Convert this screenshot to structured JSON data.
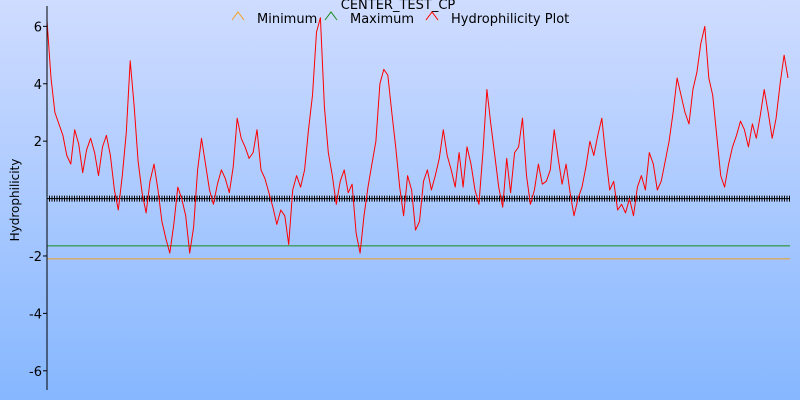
{
  "colors": {
    "background_top": "#cfdcff",
    "background_bottom": "#86b7ff",
    "axis": "#000000",
    "minimum": "#f0a020",
    "maximum": "#1a8c1a",
    "hydrophilicity": "#ff0000",
    "baseline_markers": "#000000"
  },
  "chart_data": {
    "type": "line",
    "title": "CENTER_TEST_CP",
    "xlabel": "",
    "ylabel": "Hydrophilicity",
    "ylim": [
      -6.6,
      6.5
    ],
    "xlim": [
      0,
      750
    ],
    "yticks": [
      -6,
      -4,
      -2,
      2,
      4,
      6
    ],
    "ytick_labels": [
      "-6",
      "-4",
      "-2",
      "2",
      "4",
      "6"
    ],
    "grid": false,
    "legend": {
      "placement": "top-center",
      "entries": [
        "Minimum",
        "Maximum",
        "Hydrophilicity Plot"
      ]
    },
    "reference_lines": [
      {
        "name": "Minimum",
        "y": -2.1
      },
      {
        "name": "Maximum",
        "y": -1.65
      }
    ],
    "baseline_y": 0,
    "series": [
      {
        "name": "Hydrophilicity Plot",
        "x": [
          0,
          4,
          8,
          12,
          16,
          20,
          24,
          28,
          32,
          36,
          40,
          44,
          48,
          52,
          56,
          60,
          64,
          68,
          72,
          76,
          80,
          84,
          88,
          92,
          96,
          100,
          104,
          108,
          112,
          116,
          120,
          124,
          128,
          132,
          136,
          140,
          144,
          148,
          152,
          156,
          160,
          164,
          168,
          172,
          176,
          180,
          184,
          188,
          192,
          196,
          200,
          204,
          208,
          212,
          216,
          220,
          224,
          228,
          232,
          236,
          240,
          244,
          248,
          252,
          256,
          260,
          264,
          268,
          272,
          276,
          280,
          284,
          288,
          292,
          296,
          300,
          304,
          308,
          312,
          316,
          320,
          324,
          328,
          332,
          336,
          340,
          344,
          348,
          352,
          356,
          360,
          364,
          368,
          372,
          376,
          380,
          384,
          388,
          392,
          396,
          400,
          404,
          408,
          412,
          416,
          420,
          424,
          428,
          432,
          436,
          440,
          444,
          448,
          452,
          456,
          460,
          464,
          468,
          472,
          476,
          480,
          484,
          488,
          492,
          496,
          500,
          504,
          508,
          512,
          516,
          520,
          524,
          528,
          532,
          536,
          540,
          544,
          548,
          552,
          556,
          560,
          564,
          568,
          572,
          576,
          580,
          584,
          588,
          592,
          596,
          600,
          604,
          608,
          612,
          616,
          620,
          624,
          628,
          632,
          636,
          640,
          644,
          648,
          652,
          656,
          660,
          664,
          668,
          672,
          676,
          680,
          684,
          688,
          692,
          696,
          700,
          704,
          708,
          712,
          716,
          720,
          724,
          728,
          732,
          736,
          740,
          744,
          748
        ],
        "values": [
          6.2,
          4.2,
          3.0,
          2.6,
          2.2,
          1.5,
          1.2,
          2.4,
          1.9,
          0.9,
          1.7,
          2.1,
          1.6,
          0.8,
          1.8,
          2.2,
          1.5,
          0.3,
          -0.4,
          0.8,
          2.3,
          4.8,
          3.2,
          1.3,
          0.2,
          -0.5,
          0.6,
          1.2,
          0.3,
          -0.8,
          -1.4,
          -1.9,
          -0.9,
          0.4,
          0.0,
          -0.6,
          -1.9,
          -1.0,
          1.0,
          2.1,
          1.2,
          0.3,
          -0.2,
          0.5,
          1.0,
          0.7,
          0.2,
          1.1,
          2.8,
          2.1,
          1.8,
          1.4,
          1.6,
          2.4,
          1.0,
          0.7,
          0.2,
          -0.3,
          -0.9,
          -0.4,
          -0.6,
          -1.6,
          0.3,
          0.8,
          0.4,
          1.0,
          2.4,
          3.6,
          5.8,
          6.3,
          3.2,
          1.6,
          0.8,
          -0.2,
          0.6,
          1.0,
          0.2,
          0.5,
          -1.2,
          -1.9,
          -0.6,
          0.4,
          1.2,
          2.0,
          4.0,
          4.5,
          4.3,
          3.0,
          1.8,
          0.4,
          -0.6,
          0.8,
          0.3,
          -1.1,
          -0.8,
          0.6,
          1.0,
          0.3,
          0.8,
          1.4,
          2.4,
          1.5,
          1.0,
          0.4,
          1.6,
          0.4,
          1.8,
          1.2,
          0.3,
          -0.2,
          1.6,
          3.8,
          2.6,
          1.5,
          0.4,
          -0.3,
          1.4,
          0.2,
          1.6,
          1.8,
          2.8,
          0.8,
          -0.2,
          0.3,
          1.2,
          0.5,
          0.6,
          1.0,
          2.4,
          1.4,
          0.5,
          1.2,
          0.2,
          -0.6,
          0.0,
          0.4,
          1.1,
          2.0,
          1.5,
          2.2,
          2.8,
          1.5,
          0.3,
          0.6,
          -0.4,
          -0.2,
          -0.5,
          0.0,
          -0.6,
          0.4,
          0.8,
          0.3,
          1.6,
          1.2,
          0.3,
          0.6,
          1.3,
          2.0,
          3.0,
          4.2,
          3.6,
          3.0,
          2.6,
          3.8,
          4.4,
          5.4,
          6.0,
          4.2,
          3.6,
          2.2,
          0.8,
          0.4,
          1.2,
          1.8,
          2.2,
          2.7,
          2.4,
          1.8,
          2.6,
          2.1,
          2.9,
          3.8,
          3.0,
          2.1,
          2.8,
          4.0,
          5.0,
          4.2
        ]
      }
    ]
  }
}
